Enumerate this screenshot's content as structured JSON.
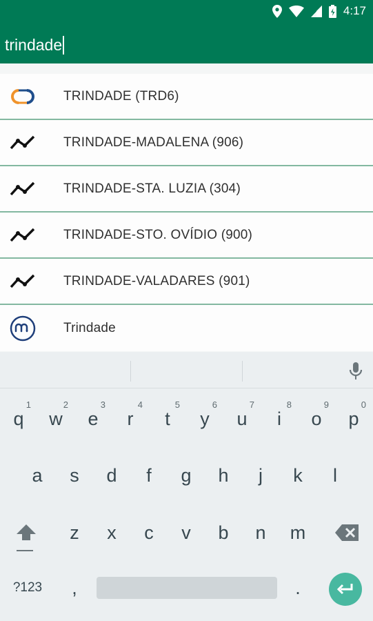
{
  "status_bar": {
    "time": "4:17"
  },
  "search": {
    "query": "trindade"
  },
  "suggestions": [
    {
      "label": "TRINDADE (TRD6)",
      "icon": "station-icon"
    },
    {
      "label": "TRINDADE-MADALENA (906)",
      "icon": "route-icon"
    },
    {
      "label": "TRINDADE-STA. LUZIA (304)",
      "icon": "route-icon"
    },
    {
      "label": "TRINDADE-STO. OVÍDIO (900)",
      "icon": "route-icon"
    },
    {
      "label": "TRINDADE-VALADARES (901)",
      "icon": "route-icon"
    },
    {
      "label": "Trindade",
      "icon": "metro-icon"
    }
  ],
  "keyboard": {
    "row1": [
      "q",
      "w",
      "e",
      "r",
      "t",
      "y",
      "u",
      "i",
      "o",
      "p"
    ],
    "row1_digits": [
      "1",
      "2",
      "3",
      "4",
      "5",
      "6",
      "7",
      "8",
      "9",
      "0"
    ],
    "row2": [
      "a",
      "s",
      "d",
      "f",
      "g",
      "h",
      "j",
      "k",
      "l"
    ],
    "row3": [
      "z",
      "x",
      "c",
      "v",
      "b",
      "n",
      "m"
    ],
    "symbols_label": "?123",
    "comma": ",",
    "period": "."
  },
  "colors": {
    "header": "#007a55",
    "enter_key": "#48b8a0",
    "divider": "#83b8a0"
  }
}
